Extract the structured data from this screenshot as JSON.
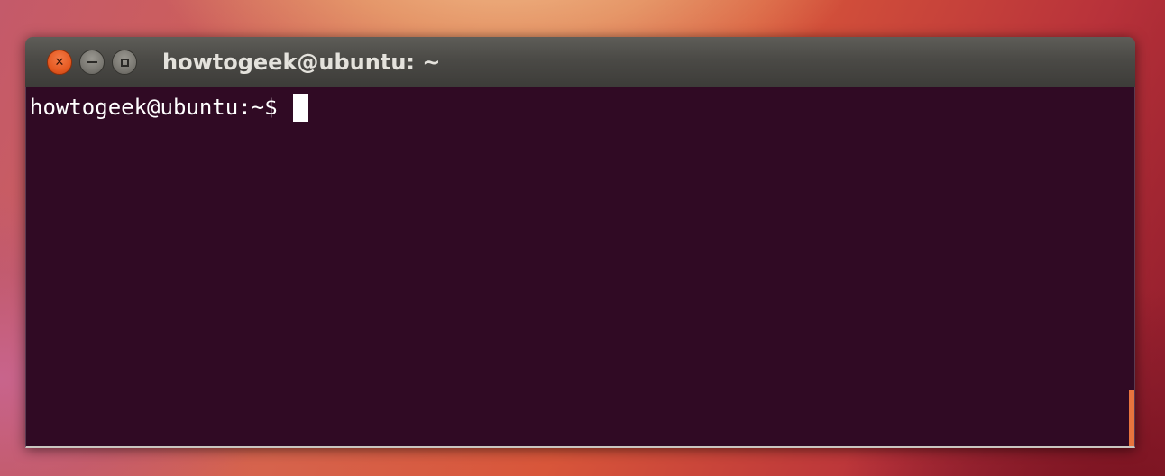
{
  "window": {
    "title": "howtogeek@ubuntu: ~",
    "controls": {
      "close_icon": "close-icon",
      "minimize_icon": "minimize-icon",
      "maximize_icon": "maximize-icon"
    }
  },
  "terminal": {
    "prompt": "howtogeek@ubuntu:~$",
    "background_color": "#300a24",
    "text_color": "#ffffff",
    "scroll_accent_color": "#e8743e"
  }
}
